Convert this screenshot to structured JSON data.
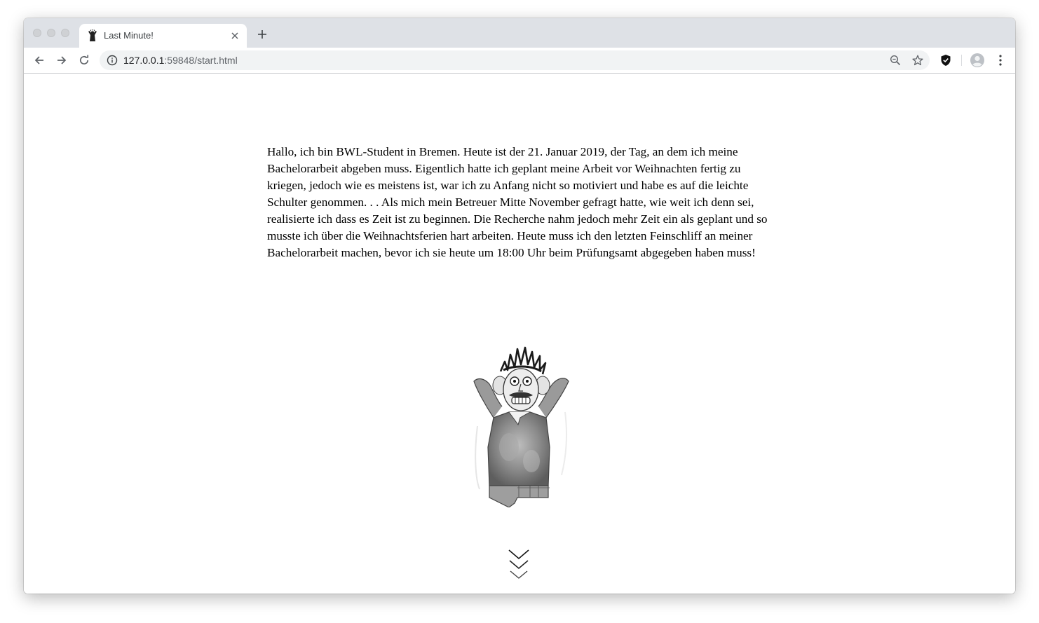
{
  "browser": {
    "tab": {
      "title": "Last Minute!",
      "favicon": "stressed-man-favicon-icon",
      "close_icon": "close-icon"
    },
    "new_tab_icon": "plus-icon",
    "nav": {
      "back_icon": "arrow-left-icon",
      "forward_icon": "arrow-right-icon",
      "reload_icon": "reload-icon"
    },
    "address": {
      "host": "127.0.0.1",
      "port": ":59848",
      "path": "/start.html",
      "info_icon": "info-icon",
      "zoom_icon": "zoom-out-icon",
      "bookmark_icon": "star-icon"
    },
    "extensions": {
      "shield_icon": "shield-icon",
      "profile_icon": "profile-avatar-icon",
      "menu_icon": "more-vert-icon"
    },
    "colors": {
      "tabstrip": "#dee1e6",
      "omnibox": "#f1f3f4",
      "icon": "#5f6368"
    }
  },
  "page": {
    "story": "Hallo, ich bin BWL-Student in Bremen. Heute ist der 21. Januar 2019, der Tag, an dem ich meine Bachelorarbeit abgeben muss. Eigentlich hatte ich geplant meine Arbeit vor Weihnachten fertig zu kriegen, jedoch wie es meistens ist, war ich zu Anfang nicht so motiviert und habe es auf die leichte Schulter genommen. . . Als mich mein Betreuer Mitte November gefragt hatte, wie weit ich denn sei, realisierte ich dass es Zeit ist zu beginnen. Die Recherche nahm jedoch mehr Zeit ein als geplant und so musste ich über die Weihnachtsferien hart arbeiten. Heute muss ich den letzten Feinschliff an meiner Bachelorarbeit machen, bevor ich sie heute um 18:00 Uhr beim Prüfungsamt abgegeben haben muss!",
    "illustration": "stressed-student-illustration",
    "scroll_indicator": "triple-chevron-down-icon"
  }
}
